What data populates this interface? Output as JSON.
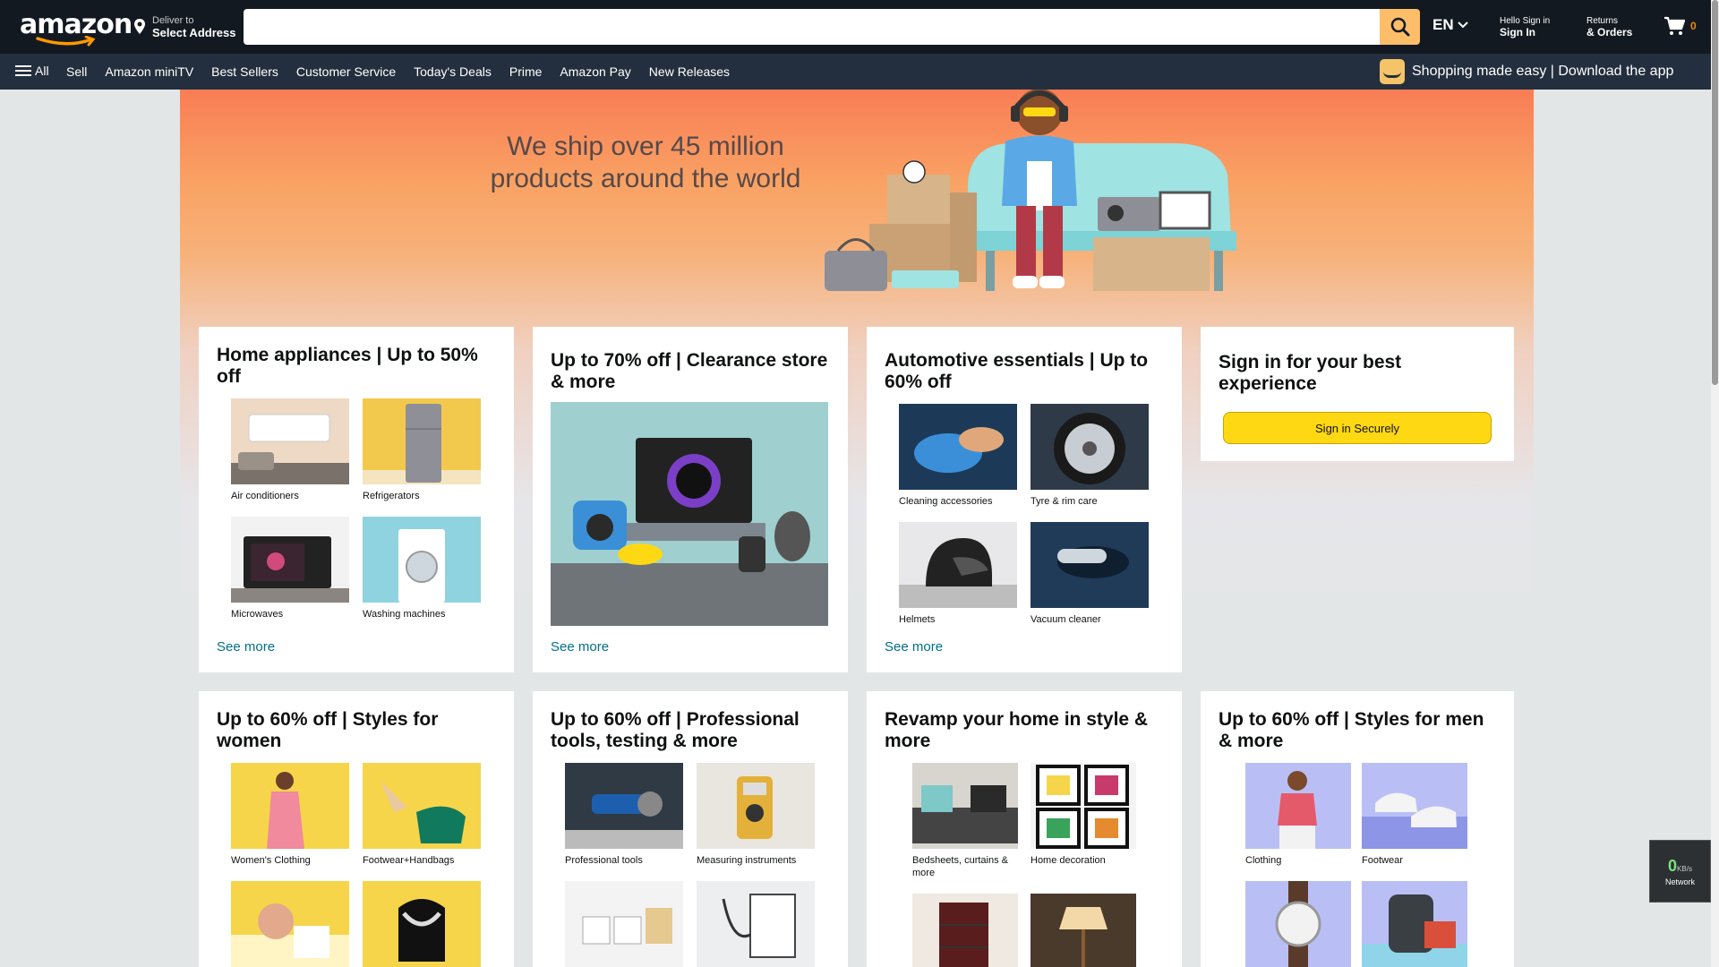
{
  "header": {
    "logo_text": "amazon",
    "deliver_line1": "Deliver to",
    "deliver_line2": "Select Address",
    "search_placeholder": "",
    "language": "EN",
    "account_line1": "Hello Sign in",
    "account_line2": "Sign In",
    "returns_line1": "Returns",
    "returns_line2": "& Orders",
    "cart_count": "0"
  },
  "subnav": {
    "all_label": "All",
    "links": [
      "Sell",
      "Amazon miniTV",
      "Best Sellers",
      "Customer Service",
      "Today's Deals",
      "Prime",
      "Amazon Pay",
      "New Releases"
    ],
    "promo": "Shopping made easy | Download the app"
  },
  "hero": {
    "line1": "We ship over 45 million",
    "line2": "products around the world"
  },
  "cards": [
    {
      "title": "Home appliances | Up to 50% off",
      "tiles": [
        "Air conditioners",
        "Refrigerators",
        "Microwaves",
        "Washing machines"
      ],
      "see_more": "See more"
    },
    {
      "title": "Up to 70% off | Clearance store & more",
      "see_more": "See more"
    },
    {
      "title": "Automotive essentials | Up to 60% off",
      "tiles": [
        "Cleaning accessories",
        "Tyre & rim care",
        "Helmets",
        "Vacuum cleaner"
      ],
      "see_more": "See more"
    },
    {
      "title": "Sign in for your best experience",
      "button": "Sign in Securely"
    },
    {
      "title": "Up to 60% off | Styles for women",
      "tiles": [
        "Women's Clothing",
        "Footwear+Handbags",
        "",
        ""
      ]
    },
    {
      "title": "Up to 60% off | Professional tools, testing & more",
      "tiles": [
        "Professional tools",
        "Measuring instruments",
        "",
        ""
      ]
    },
    {
      "title": "Revamp your home in style & more",
      "tiles": [
        "Bedsheets, curtains & more",
        "Home decoration",
        "",
        ""
      ]
    },
    {
      "title": "Up to 60% off | Styles for men & more",
      "tiles": [
        "Clothing",
        "Footwear",
        "",
        ""
      ]
    }
  ],
  "network_widget": {
    "value": "0",
    "unit": "KB/s",
    "label": "Network"
  }
}
